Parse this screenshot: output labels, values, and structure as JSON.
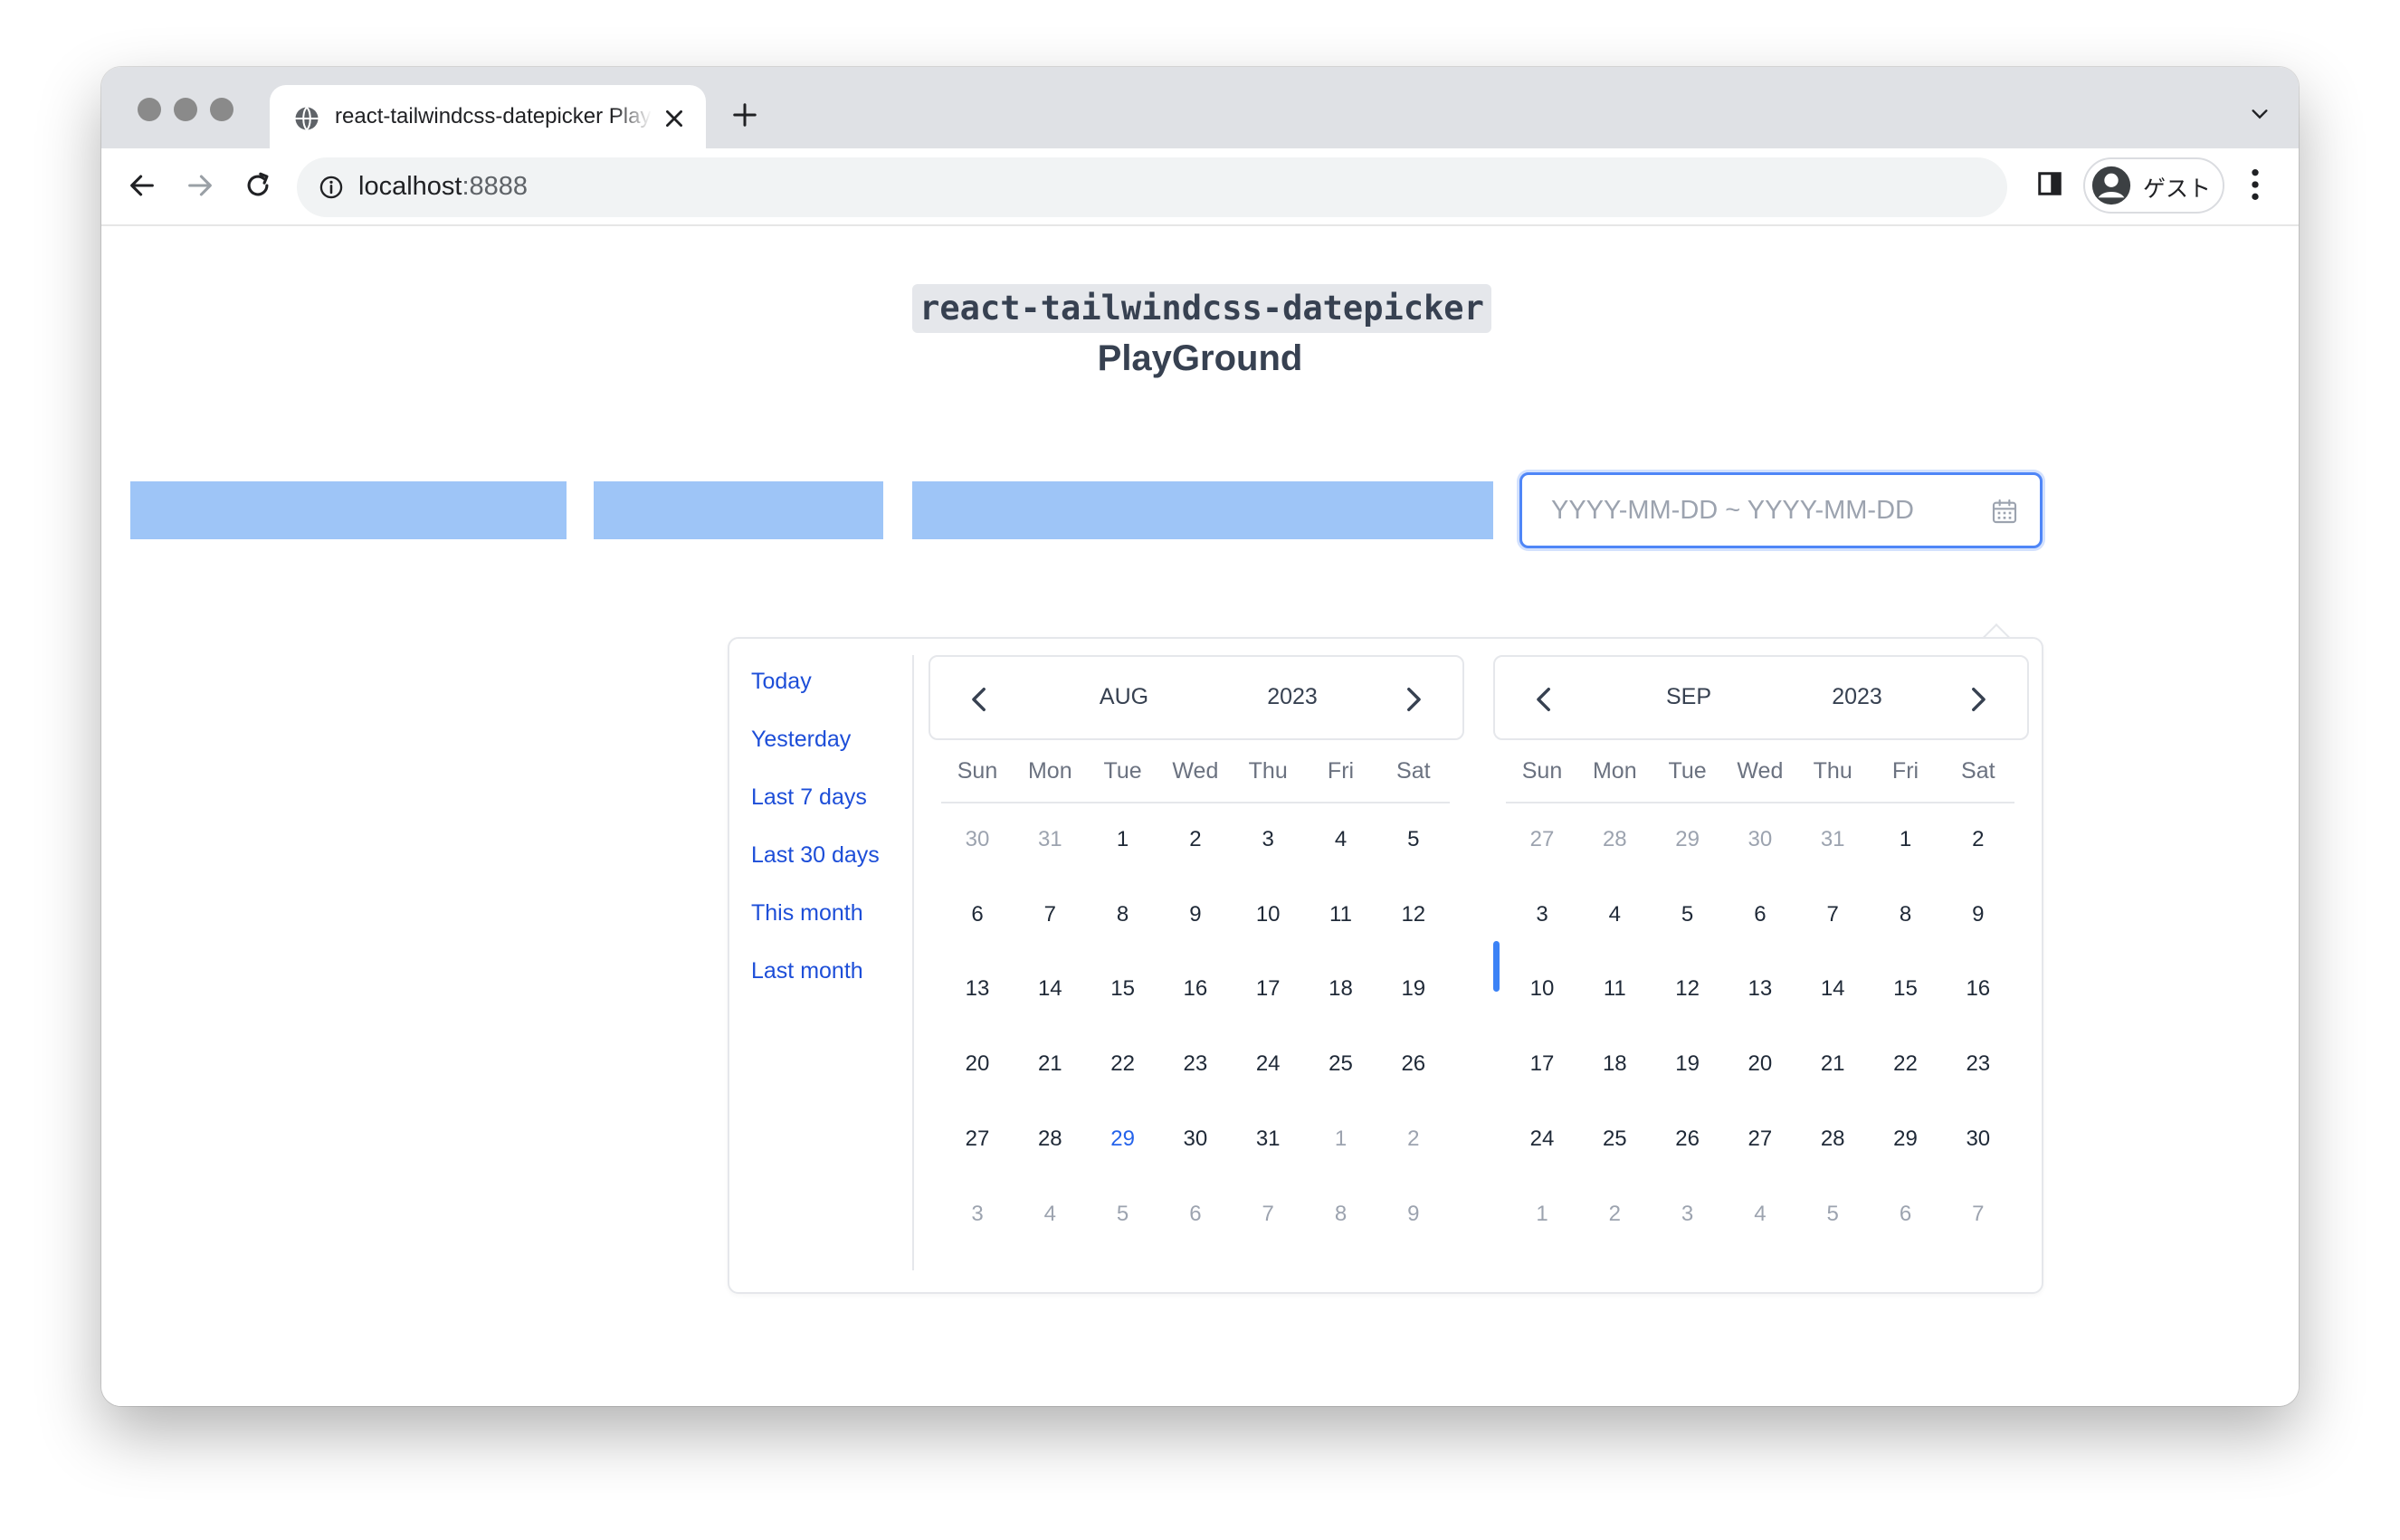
{
  "browser": {
    "tab_title": "react-tailwindcss-datepicker PlayGround",
    "url_host": "localhost",
    "url_port": ":8888",
    "profile_label": "ゲスト"
  },
  "page": {
    "heading_code": "react-tailwindcss-datepicker",
    "heading_sub": "PlayGround"
  },
  "colors": {
    "accent": "#3b82f6",
    "link": "#1d4ed8",
    "placeholder_bars": "#9ec5f7"
  },
  "datepicker": {
    "placeholder": "YYYY-MM-DD ~ YYYY-MM-DD",
    "shortcuts": [
      "Today",
      "Yesterday",
      "Last 7 days",
      "Last 30 days",
      "This month",
      "Last month"
    ],
    "weekdays": [
      "Sun",
      "Mon",
      "Tue",
      "Wed",
      "Thu",
      "Fri",
      "Sat"
    ],
    "left": {
      "month": "AUG",
      "year": "2023",
      "weeks": [
        [
          "30",
          "31",
          "1",
          "2",
          "3",
          "4",
          "5"
        ],
        [
          "6",
          "7",
          "8",
          "9",
          "10",
          "11",
          "12"
        ],
        [
          "13",
          "14",
          "15",
          "16",
          "17",
          "18",
          "19"
        ],
        [
          "20",
          "21",
          "22",
          "23",
          "24",
          "25",
          "26"
        ],
        [
          "27",
          "28",
          "29",
          "30",
          "31",
          "1",
          "2"
        ],
        [
          "3",
          "4",
          "5",
          "6",
          "7",
          "8",
          "9"
        ]
      ],
      "muted": [
        [
          0,
          0
        ],
        [
          0,
          1
        ],
        [
          4,
          5
        ],
        [
          4,
          6
        ],
        [
          5,
          0
        ],
        [
          5,
          1
        ],
        [
          5,
          2
        ],
        [
          5,
          3
        ],
        [
          5,
          4
        ],
        [
          5,
          5
        ],
        [
          5,
          6
        ]
      ],
      "today": [
        4,
        2
      ]
    },
    "right": {
      "month": "SEP",
      "year": "2023",
      "weeks": [
        [
          "27",
          "28",
          "29",
          "30",
          "31",
          "1",
          "2"
        ],
        [
          "3",
          "4",
          "5",
          "6",
          "7",
          "8",
          "9"
        ],
        [
          "10",
          "11",
          "12",
          "13",
          "14",
          "15",
          "16"
        ],
        [
          "17",
          "18",
          "19",
          "20",
          "21",
          "22",
          "23"
        ],
        [
          "24",
          "25",
          "26",
          "27",
          "28",
          "29",
          "30"
        ],
        [
          "1",
          "2",
          "3",
          "4",
          "5",
          "6",
          "7"
        ]
      ],
      "muted": [
        [
          0,
          0
        ],
        [
          0,
          1
        ],
        [
          0,
          2
        ],
        [
          0,
          3
        ],
        [
          0,
          4
        ],
        [
          5,
          0
        ],
        [
          5,
          1
        ],
        [
          5,
          2
        ],
        [
          5,
          3
        ],
        [
          5,
          4
        ],
        [
          5,
          5
        ],
        [
          5,
          6
        ]
      ],
      "today": null
    }
  }
}
